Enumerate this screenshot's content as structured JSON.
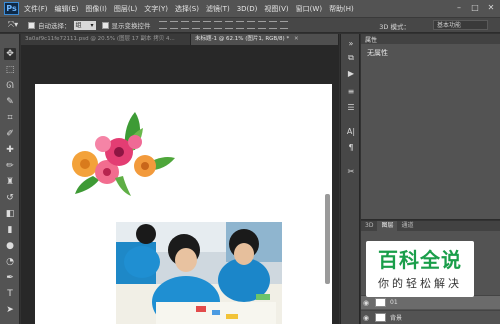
{
  "app": {
    "logo_text": "Ps",
    "menu": [
      "文件(F)",
      "编辑(E)",
      "图像(I)",
      "图层(L)",
      "文字(Y)",
      "选择(S)",
      "滤镜(T)",
      "3D(D)",
      "视图(V)",
      "窗口(W)",
      "帮助(H)"
    ],
    "window_controls": [
      "–",
      "□",
      "✕"
    ]
  },
  "options": {
    "auto_select_label": "自动选择：",
    "auto_select_value": "组",
    "transform_label": "显示变换控件",
    "mode_3d": "3D 模式：",
    "workspace": "基本功能"
  },
  "tabs": [
    {
      "label": "3a0af9c11fe72111.psd @ 20.5% (图层 17 副本 拷贝 4...",
      "active": false
    },
    {
      "label": "未标题-1 @ 62.1% (图片1, RGB/8) *",
      "active": true
    }
  ],
  "props_panel": {
    "title": "属性",
    "content": "无属性"
  },
  "layers_panel": {
    "tabs": [
      "3D",
      "图层",
      "通道"
    ],
    "rows": [
      "01",
      "背景"
    ]
  },
  "watermark": {
    "title": "百科全说",
    "subtitle": "你的轻松解决"
  },
  "icons": {
    "close": "close-icon",
    "eye": "eye-icon"
  }
}
